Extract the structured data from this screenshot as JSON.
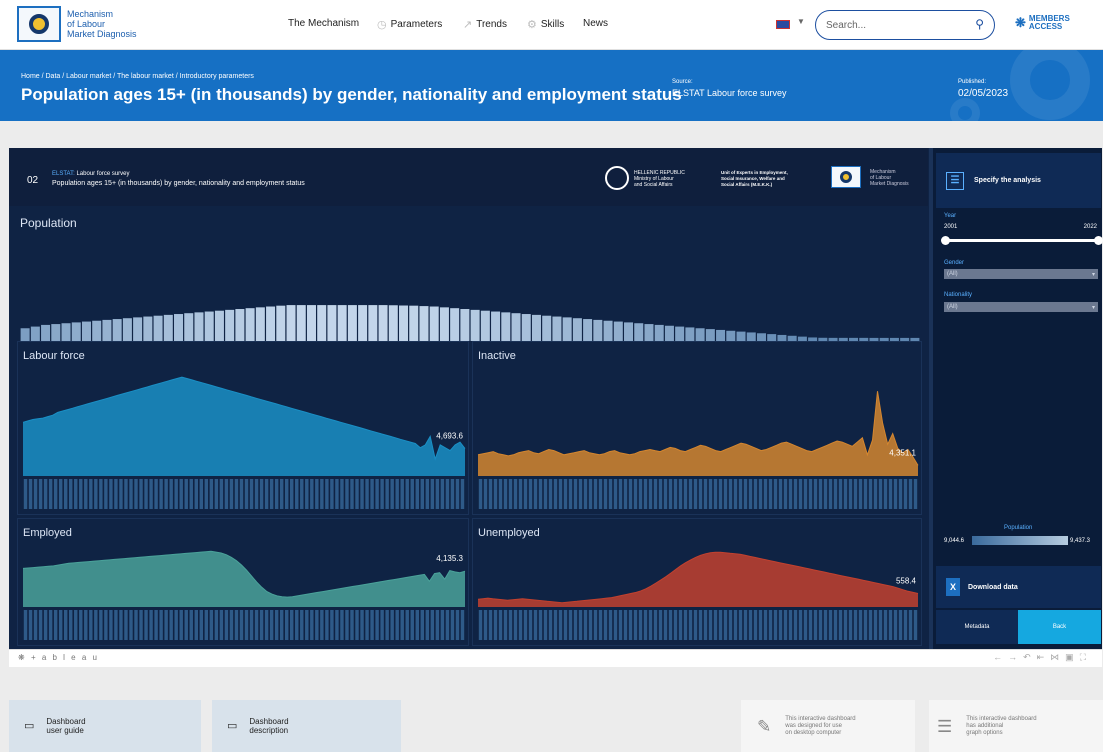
{
  "header": {
    "logo_text": [
      "Mechanism",
      "of Labour",
      "Market Diagnosis"
    ],
    "nav": [
      {
        "label": "The Mechanism",
        "icon": ""
      },
      {
        "label": "Parameters",
        "icon": "clock-icon"
      },
      {
        "label": "Trends",
        "icon": "trend-icon"
      },
      {
        "label": "Skills",
        "icon": "skills-icon"
      },
      {
        "label": "News",
        "icon": ""
      }
    ],
    "search_placeholder": "Search...",
    "members_label": [
      "MEMBERS",
      "ACCESS"
    ]
  },
  "banner": {
    "breadcrumb": "Home / Data / Labour market / The labour market / Introductory parameters",
    "title": "Population ages 15+ (in thousands) by gender, nationality and employment status",
    "source_label": "Source:",
    "source_value": "ELSTAT Labour force survey",
    "published_label": "Published:",
    "published_value": "02/05/2023"
  },
  "dashboard": {
    "number": "02",
    "source_prefix": "ELSTAT:",
    "source_text": "Labour force survey",
    "title": "Population ages 15+ (in thousands) by gender, nationality and employment status",
    "hellenic": [
      "HELLENIC REPUBLIC",
      "Ministry of Labour",
      "and Social Affairs"
    ],
    "meke": [
      "Unit of Experts in Employment,",
      "Social Insurance, Welfare and",
      "Social Affairs (M.E.K.K.)"
    ],
    "mechanism": [
      "Mechanism",
      "of Labour",
      "Market Diagnosis"
    ]
  },
  "sidebar": {
    "specify_label": "Specify the analysis",
    "year_label": "Year",
    "year_from": "2001",
    "year_to": "2022",
    "gender_label": "Gender",
    "gender_value": "(All)",
    "nationality_label": "Nationality",
    "nationality_value": "(All)",
    "legend_label": "Population",
    "legend_min": "9,044.6",
    "legend_max": "9,437.3",
    "download_label": "Download data",
    "metadata_label": "Metadata",
    "back_label": "Back"
  },
  "tableau": {
    "logo": "+ a b l e a u"
  },
  "cards": [
    {
      "icon": "pdf-icon",
      "lines": [
        "Dashboard",
        "user guide"
      ]
    },
    {
      "icon": "pdf-icon",
      "lines": [
        "Dashboard",
        "description"
      ]
    },
    {
      "icon": "desktop-icon",
      "lines": [
        "This interactive dashboard",
        "was designed for use",
        "on desktop computer"
      ]
    },
    {
      "icon": "options-icon",
      "lines": [
        "This interactive dashboard",
        "has additional",
        "graph options"
      ]
    }
  ],
  "chart_data": [
    {
      "type": "bar",
      "title": "Population",
      "last_label": "9,044.6",
      "ylim": [
        8900,
        9450
      ],
      "period": [
        "2001 Q1",
        "2022 Q4"
      ],
      "values": [
        9160,
        9180,
        9200,
        9210,
        9220,
        9230,
        9240,
        9250,
        9260,
        9270,
        9280,
        9290,
        9300,
        9310,
        9320,
        9330,
        9340,
        9350,
        9360,
        9370,
        9380,
        9390,
        9400,
        9410,
        9420,
        9430,
        9437,
        9437,
        9437,
        9437,
        9437,
        9437,
        9437,
        9437,
        9437,
        9437,
        9435,
        9432,
        9430,
        9425,
        9420,
        9410,
        9400,
        9390,
        9380,
        9370,
        9360,
        9350,
        9340,
        9330,
        9320,
        9310,
        9300,
        9290,
        9280,
        9270,
        9260,
        9250,
        9240,
        9230,
        9220,
        9210,
        9200,
        9190,
        9180,
        9170,
        9160,
        9150,
        9140,
        9130,
        9120,
        9110,
        9100,
        9090,
        9080,
        9070,
        9060,
        9050,
        9046,
        9045,
        9045,
        9045,
        9045,
        9044.6,
        9044.6,
        9044.6,
        9044.6,
        9044.6
      ]
    },
    {
      "type": "area",
      "title": "Labour force",
      "last_label": "4,693.6",
      "color": "#1a8fc5",
      "ylim": [
        4500,
        5250
      ],
      "values": [
        4880,
        4890,
        4900,
        4905,
        4910,
        4920,
        4930,
        4950,
        4960,
        4970,
        4980,
        4990,
        5000,
        5010,
        5020,
        5030,
        5040,
        5050,
        5060,
        5070,
        5080,
        5090,
        5100,
        5110,
        5120,
        5130,
        5140,
        5150,
        5160,
        5170,
        5180,
        5190,
        5200,
        5190,
        5180,
        5170,
        5160,
        5150,
        5140,
        5130,
        5120,
        5110,
        5100,
        5090,
        5080,
        5070,
        5060,
        5050,
        5040,
        5030,
        5020,
        5010,
        5000,
        4990,
        4980,
        4970,
        4960,
        4950,
        4940,
        4930,
        4920,
        4910,
        4900,
        4890,
        4880,
        4870,
        4860,
        4850,
        4840,
        4830,
        4820,
        4810,
        4800,
        4790,
        4780,
        4770,
        4760,
        4750,
        4740,
        4730,
        4700,
        4720,
        4780,
        4620,
        4720,
        4700,
        4680,
        4720,
        4740,
        4693.6
      ]
    },
    {
      "type": "area",
      "title": "Inactive",
      "last_label": "4,351.1",
      "color": "#d4862f",
      "ylim": [
        4100,
        5100
      ],
      "values": [
        4300,
        4310,
        4320,
        4330,
        4310,
        4300,
        4290,
        4300,
        4320,
        4330,
        4340,
        4320,
        4310,
        4330,
        4350,
        4340,
        4320,
        4300,
        4310,
        4320,
        4330,
        4340,
        4320,
        4310,
        4300,
        4310,
        4330,
        4340,
        4320,
        4310,
        4300,
        4310,
        4330,
        4340,
        4350,
        4340,
        4330,
        4350,
        4370,
        4360,
        4340,
        4330,
        4350,
        4370,
        4390,
        4380,
        4360,
        4340,
        4330,
        4350,
        4370,
        4390,
        4410,
        4400,
        4380,
        4360,
        4340,
        4350,
        4370,
        4390,
        4410,
        4420,
        4400,
        4380,
        4360,
        4340,
        4330,
        4350,
        4370,
        4390,
        4410,
        4430,
        4420,
        4400,
        4380,
        4420,
        4460,
        4300,
        4440,
        4900,
        4600,
        4400,
        4500,
        4360,
        4320,
        4351.1,
        4280,
        4200
      ]
    },
    {
      "type": "area",
      "title": "Employed",
      "last_label": "4,135.3",
      "color": "#4aa29a",
      "ylim": [
        3300,
        4700
      ],
      "values": [
        4200,
        4210,
        4220,
        4230,
        4240,
        4250,
        4260,
        4280,
        4300,
        4320,
        4330,
        4340,
        4350,
        4360,
        4370,
        4380,
        4390,
        4400,
        4410,
        4420,
        4430,
        4440,
        4450,
        4460,
        4470,
        4480,
        4490,
        4500,
        4510,
        4520,
        4530,
        4540,
        4550,
        4560,
        4570,
        4580,
        4590,
        4600,
        4580,
        4560,
        4520,
        4460,
        4380,
        4280,
        4160,
        4020,
        3880,
        3760,
        3660,
        3600,
        3560,
        3540,
        3530,
        3540,
        3560,
        3580,
        3600,
        3620,
        3640,
        3660,
        3680,
        3700,
        3720,
        3740,
        3760,
        3780,
        3800,
        3820,
        3840,
        3860,
        3880,
        3900,
        3920,
        3940,
        3960,
        3980,
        4000,
        4020,
        4040,
        4060,
        3900,
        4080,
        4100,
        3950,
        4150,
        4120,
        4100,
        4135.3
      ]
    },
    {
      "type": "area",
      "title": "Unemployed",
      "last_label": "558.4",
      "color": "#c2412f",
      "ylim": [
        300,
        1450
      ],
      "values": [
        450,
        460,
        470,
        460,
        450,
        440,
        430,
        440,
        450,
        460,
        450,
        440,
        430,
        420,
        410,
        400,
        390,
        380,
        390,
        400,
        410,
        420,
        430,
        440,
        450,
        460,
        470,
        480,
        500,
        520,
        540,
        560,
        580,
        610,
        650,
        700,
        760,
        820,
        880,
        950,
        1020,
        1090,
        1150,
        1200,
        1250,
        1290,
        1320,
        1340,
        1350,
        1350,
        1340,
        1330,
        1320,
        1310,
        1290,
        1270,
        1250,
        1230,
        1210,
        1190,
        1170,
        1150,
        1130,
        1110,
        1090,
        1070,
        1050,
        1030,
        1010,
        990,
        970,
        950,
        930,
        910,
        890,
        870,
        850,
        830,
        810,
        790,
        770,
        750,
        730,
        710,
        690,
        660,
        630,
        600,
        580,
        558.4
      ]
    }
  ]
}
